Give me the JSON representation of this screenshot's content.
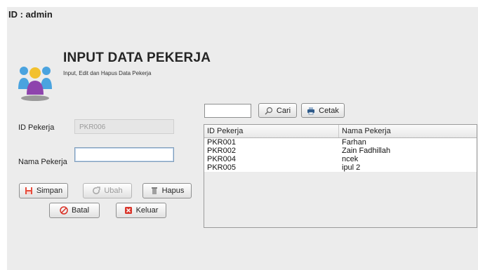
{
  "header": {
    "user_id": "ID : admin",
    "title": "INPUT DATA PEKERJA",
    "subtitle": "Input, Edit dan Hapus Data Pekerja",
    "logo_icon": "users-group-icon"
  },
  "form": {
    "id_label": "ID Pekerja",
    "id_value": "PKR006",
    "name_label": "Nama Pekerja",
    "name_value": ""
  },
  "buttons": {
    "simpan": "Simpan",
    "ubah": "Ubah",
    "hapus": "Hapus",
    "batal": "Batal",
    "keluar": "Keluar"
  },
  "search": {
    "value": "",
    "cari": "Cari",
    "cetak": "Cetak"
  },
  "table": {
    "columns": [
      "ID Pekerja",
      "Nama Pekerja"
    ],
    "rows": [
      [
        "PKR001",
        "Farhan"
      ],
      [
        "PKR002",
        "Zain Fadhillah"
      ],
      [
        "PKR004",
        "ncek"
      ],
      [
        "PKR005",
        "ipul 2"
      ]
    ]
  },
  "colors": {
    "panel_bg": "#ececec",
    "logo_blue": "#4aa3df",
    "logo_yellow": "#f2c12e",
    "logo_purple": "#8e44ad",
    "save_icon": "#e74c3c",
    "cancel_icon": "#d93025"
  }
}
